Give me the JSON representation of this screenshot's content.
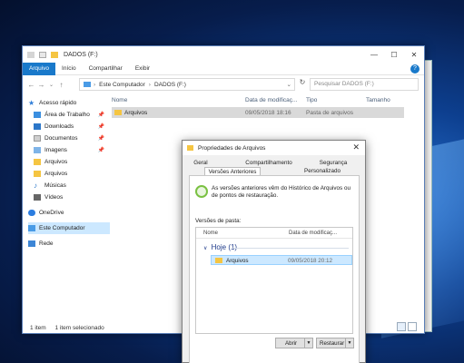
{
  "explorer": {
    "title": "DADOS (F:)",
    "window_buttons": [
      "—",
      "☐",
      "✕"
    ],
    "ribbon_tabs": [
      "Arquivo",
      "Início",
      "Compartilhar",
      "Exibir"
    ],
    "help": "?",
    "address": [
      "Este Computador",
      "DADOS (F:)"
    ],
    "search_placeholder": "Pesquisar DADOS (F:)",
    "nav": [
      {
        "label": "Acesso rápido",
        "icon": "star-icon",
        "pinned": false
      },
      {
        "label": "Área de Trabalho",
        "icon": "desktop-icon",
        "pinned": true
      },
      {
        "label": "Downloads",
        "icon": "download-icon",
        "pinned": true
      },
      {
        "label": "Documentos",
        "icon": "documents-icon",
        "pinned": true
      },
      {
        "label": "Imagens",
        "icon": "images-icon",
        "pinned": true
      },
      {
        "label": "Arquivos",
        "icon": "folder-icon",
        "pinned": false
      },
      {
        "label": "Arquivos",
        "icon": "folder-icon",
        "pinned": false
      },
      {
        "label": "Músicas",
        "icon": "music-icon",
        "pinned": false
      },
      {
        "label": "Vídeos",
        "icon": "videos-icon",
        "pinned": false
      },
      {
        "label": "OneDrive",
        "icon": "cloud-icon",
        "pinned": false
      },
      {
        "label": "Este Computador",
        "icon": "computer-icon",
        "pinned": false
      },
      {
        "label": "Rede",
        "icon": "network-icon",
        "pinned": false
      }
    ],
    "columns": [
      "Nome",
      "Data de modificaç...",
      "Tipo",
      "Tamanho"
    ],
    "files": [
      {
        "name": "Arquivos",
        "date": "09/05/2018 18:16",
        "type": "Pasta de arquivos",
        "size": ""
      }
    ],
    "status": {
      "count": "1 item",
      "selected": "1 item selecionado"
    }
  },
  "dialog": {
    "title": "Propriedades de Arquivos",
    "close": "✕",
    "tabs_row1": [
      "Geral",
      "Compartilhamento",
      "Segurança"
    ],
    "tabs_row2": [
      "Versões Anteriores",
      "Personalizado"
    ],
    "info": "As versões anteriores vêm do Histórico de Arquivos ou de pontos de restauração.",
    "versions_label": "Versões de pasta:",
    "list_columns": [
      "Nome",
      "Data de modificaç..."
    ],
    "group": "Hoje (1)",
    "versions": [
      {
        "name": "Arquivos",
        "date": "09/05/2018 20:12"
      }
    ],
    "buttons": {
      "open": "Abrir",
      "restore": "Restaurar"
    }
  }
}
